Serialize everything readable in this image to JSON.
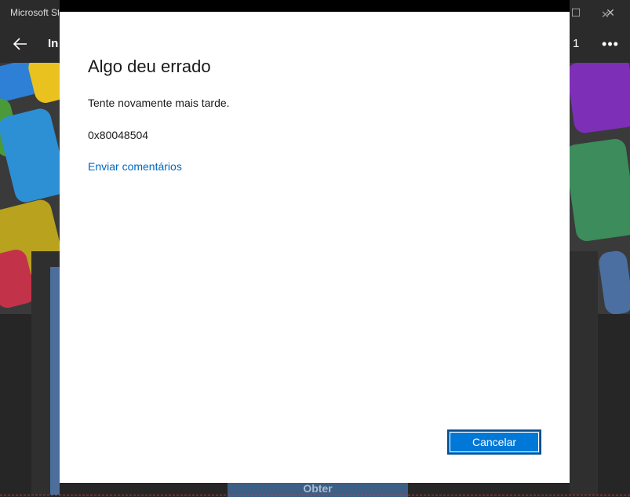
{
  "window": {
    "title": "Microsoft Store",
    "minimize_glyph": "—",
    "maximize_glyph": "☐",
    "close_glyph": "✕"
  },
  "nav": {
    "back_icon": "arrow-left-icon",
    "tab_label": "Início",
    "count_label": "1",
    "more_glyph": "•••"
  },
  "background": {
    "get_button_label": "Obter"
  },
  "dialog": {
    "title": "Algo deu errado",
    "message": "Tente novamente mais tarde.",
    "error_code": "0x80048504",
    "feedback_link": "Enviar comentários",
    "cancel_label": "Cancelar",
    "close_glyph": "✕",
    "colors": {
      "accent": "#0078d7",
      "link": "#0067c0"
    }
  }
}
